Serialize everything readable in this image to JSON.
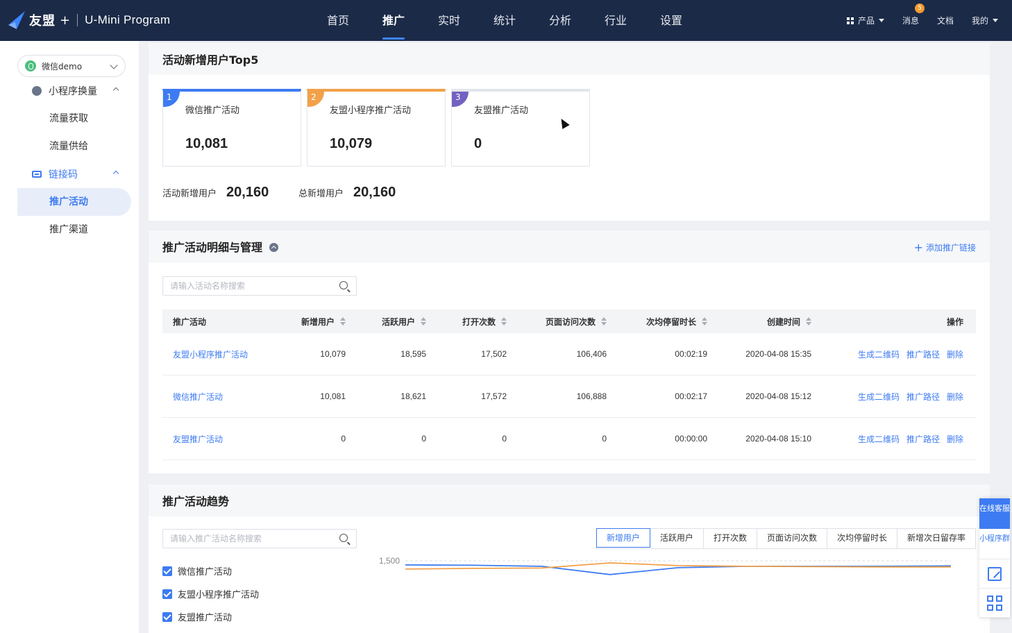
{
  "brand": {
    "name": "友盟",
    "plus": "+",
    "product": "U-Mini Program"
  },
  "nav": {
    "items": [
      {
        "label": "首页",
        "active": false
      },
      {
        "label": "推广",
        "active": true
      },
      {
        "label": "实时",
        "active": false
      },
      {
        "label": "统计",
        "active": false
      },
      {
        "label": "分析",
        "active": false
      },
      {
        "label": "行业",
        "active": false
      },
      {
        "label": "设置",
        "active": false
      }
    ]
  },
  "topright": {
    "product": "产品",
    "messages": "消息",
    "message_count": "5",
    "docs": "文档",
    "mine": "我的"
  },
  "sidebar": {
    "app_select": "微信demo",
    "group1": "小程序换量",
    "group1_items": [
      "流量获取",
      "流量供给"
    ],
    "group2": "链接码",
    "group2_items": [
      "推广活动",
      "推广渠道"
    ],
    "active_item": "推广活动"
  },
  "top5": {
    "title": "活动新增用户Top5",
    "cards": [
      {
        "rank": "1",
        "name": "微信推广活动",
        "value": "10,081"
      },
      {
        "rank": "2",
        "name": "友盟小程序推广活动",
        "value": "10,079"
      },
      {
        "rank": "3",
        "name": "友盟推广活动",
        "value": "0"
      }
    ],
    "activity_new_label": "活动新增用户",
    "activity_new_value": "20,160",
    "total_new_label": "总新增用户",
    "total_new_value": "20,160"
  },
  "detail": {
    "title": "推广活动明细与管理",
    "add_link": "添加推广链接",
    "search_placeholder": "请输入活动名称搜索",
    "columns": [
      "推广活动",
      "新增用户",
      "活跃用户",
      "打开次数",
      "页面访问次数",
      "次均停留时长",
      "创建时间",
      "操作"
    ],
    "rows": [
      {
        "name": "友盟小程序推广活动",
        "new": "10,079",
        "active": "18,595",
        "open": "17,502",
        "pv": "106,406",
        "stay": "00:02:19",
        "created": "2020-04-08 15:35"
      },
      {
        "name": "微信推广活动",
        "new": "10,081",
        "active": "18,621",
        "open": "17,572",
        "pv": "106,888",
        "stay": "00:02:17",
        "created": "2020-04-08 15:12"
      },
      {
        "name": "友盟推广活动",
        "new": "0",
        "active": "0",
        "open": "0",
        "pv": "0",
        "stay": "00:00:00",
        "created": "2020-04-08 15:10"
      }
    ],
    "ops": [
      "生成二维码",
      "推广路径",
      "删除"
    ]
  },
  "trend": {
    "title": "推广活动趋势",
    "search_placeholder": "请输入推广活动名称搜索",
    "tabs": [
      "新增用户",
      "活跃用户",
      "打开次数",
      "页面访问次数",
      "次均停留时长",
      "新增次日留存率"
    ],
    "active_tab": "新增用户",
    "legend": [
      "微信推广活动",
      "友盟小程序推广活动",
      "友盟推广活动"
    ]
  },
  "chart_data": {
    "type": "line",
    "y_tick_labels": [
      "1,500"
    ],
    "ylim_top": 1500,
    "series": [
      {
        "name": "微信推广活动",
        "color": "#3d7bf2",
        "values": [
          1440,
          1435,
          1420,
          1300,
          1400,
          1420,
          1420,
          1420,
          1425
        ]
      },
      {
        "name": "友盟小程序推广活动",
        "color": "#f2a14a",
        "values": [
          1380,
          1390,
          1395,
          1470,
          1430,
          1420,
          1415,
          1410,
          1410
        ]
      }
    ]
  },
  "float": {
    "online": "在线客服",
    "group": "小程序群"
  },
  "colors": {
    "primary": "#3d7bf2",
    "nav_bg": "#1b2a47",
    "orange": "#f2a14a",
    "purple": "#7361c2"
  }
}
